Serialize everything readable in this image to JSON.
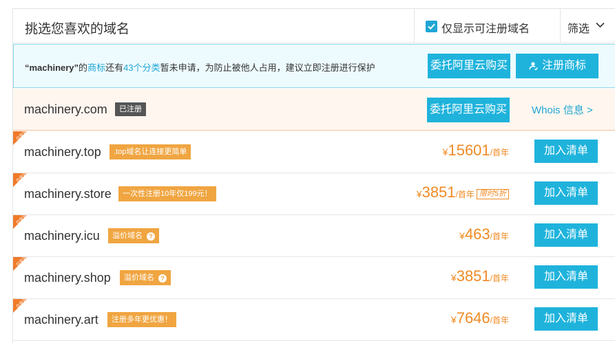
{
  "header": {
    "title": "挑选您喜欢的域名",
    "only_available_label": "仅显示可注册域名",
    "only_available_checked": true,
    "filter_label": "筛选"
  },
  "notice": {
    "keyword": "“machinery”",
    "part1": "的",
    "trademark_link": "商标",
    "part2": "还有",
    "categories_link": "43个分类",
    "part3": "暂未申请，为防止被他人占用，建议立即注册进行保护",
    "entrust_button": "委托阿里云购买",
    "register_tm_button": "注册商标"
  },
  "registered": {
    "domain": "machinery.com",
    "badge": "已注册",
    "entrust_button": "委托阿里云购买",
    "whois_link": "Whois 信息 >"
  },
  "ribbon_text": "白金词",
  "rows": [
    {
      "domain": "machinery.top",
      "tag": ".top域名让连接更简单",
      "yen": "¥",
      "price": "15601",
      "unit": "/首年",
      "promo": "",
      "button": "加入清单"
    },
    {
      "domain": "machinery.store",
      "tag": "一次性注册10年仅199元！",
      "yen": "¥",
      "price": "3851",
      "unit": "/首年",
      "promo": "限时5折",
      "button": "加入清单"
    },
    {
      "domain": "machinery.icu",
      "tag": "溢价域名",
      "yen": "¥",
      "price": "463",
      "unit": "/首年",
      "promo": "",
      "button": "加入清单"
    },
    {
      "domain": "machinery.shop",
      "tag": "溢价域名",
      "yen": "¥",
      "price": "3851",
      "unit": "/首年",
      "promo": "",
      "button": "加入清单"
    },
    {
      "domain": "machinery.art",
      "tag": "注册多年更优惠！",
      "yen": "¥",
      "price": "7646",
      "unit": "/首年",
      "promo": "",
      "button": "加入清单"
    }
  ],
  "colors": {
    "accent_blue": "#1fb3dc",
    "price_orange": "#f08a24",
    "tag_orange": "#f0a541",
    "ribbon_orange": "#f07b2a"
  }
}
